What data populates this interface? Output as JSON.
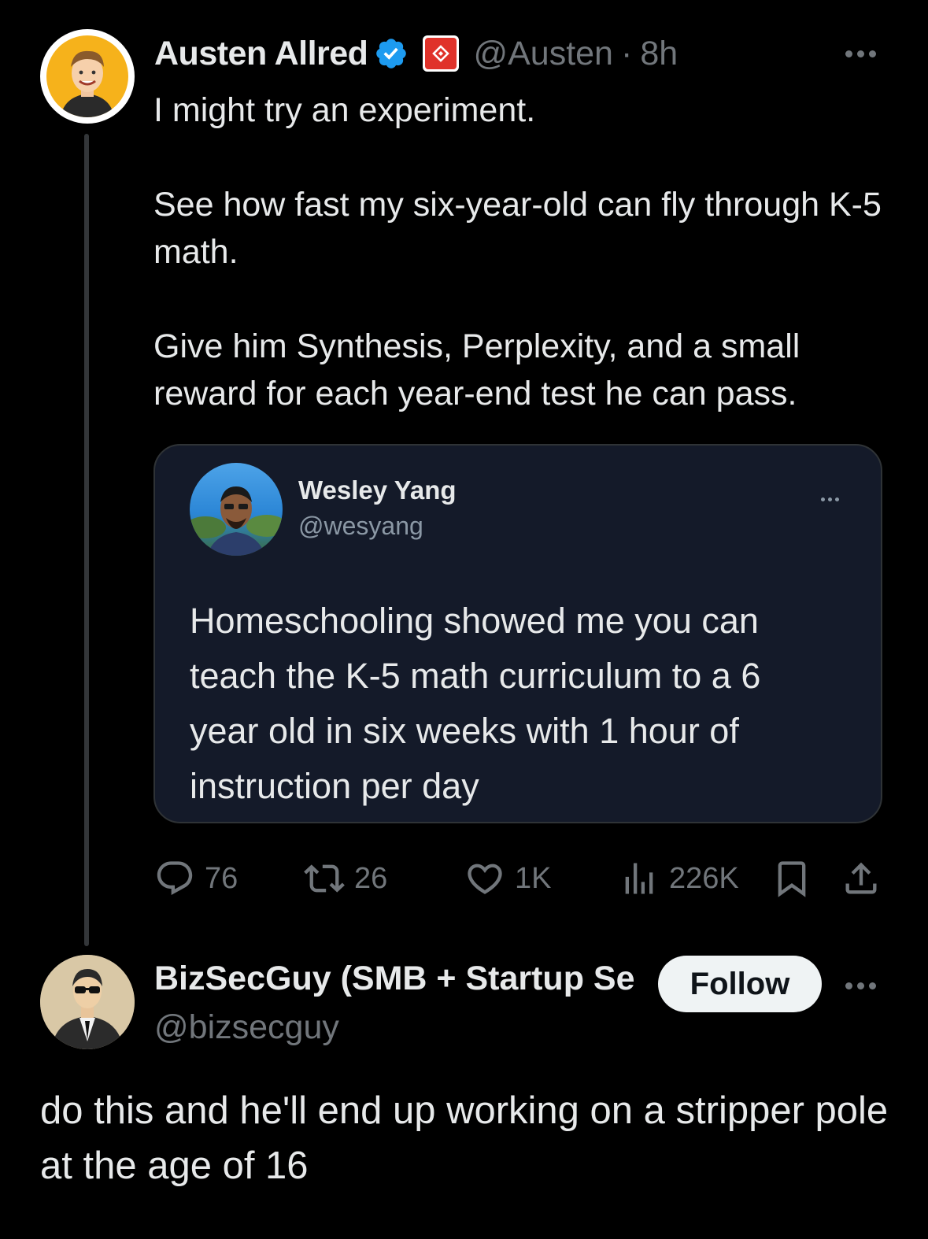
{
  "tweet": {
    "author_name": "Austen Allred",
    "handle": "@Austen",
    "separator": "·",
    "time": "8h",
    "paragraphs": [
      "I might try an experiment.",
      "See how fast my six-year-old can fly through K-5 math.",
      "Give him Synthesis, Perplexity, and a small reward for each year-end test he can pass."
    ],
    "icons": {
      "verified": "verified-badge-icon",
      "org": "affiliate-badge-icon",
      "more": "more-icon"
    },
    "colors": {
      "verified": "#1d9bf0",
      "affiliate_badge": "#e0322a"
    }
  },
  "quote": {
    "author_name": "Wesley Yang",
    "handle": "@wesyang",
    "text": "Homeschooling showed me you can teach the K-5 math curriculum to a 6 year old in six weeks with 1 hour of instruction per day"
  },
  "actions": {
    "replies": "76",
    "reposts": "26",
    "likes": "1K",
    "views": "226K"
  },
  "reply": {
    "author_name": "BizSecGuy (SMB + Startup Se",
    "handle": "@bizsecguy",
    "follow_label": "Follow",
    "text": "do this and he'll end up working on a stripper pole at the age of 16"
  }
}
